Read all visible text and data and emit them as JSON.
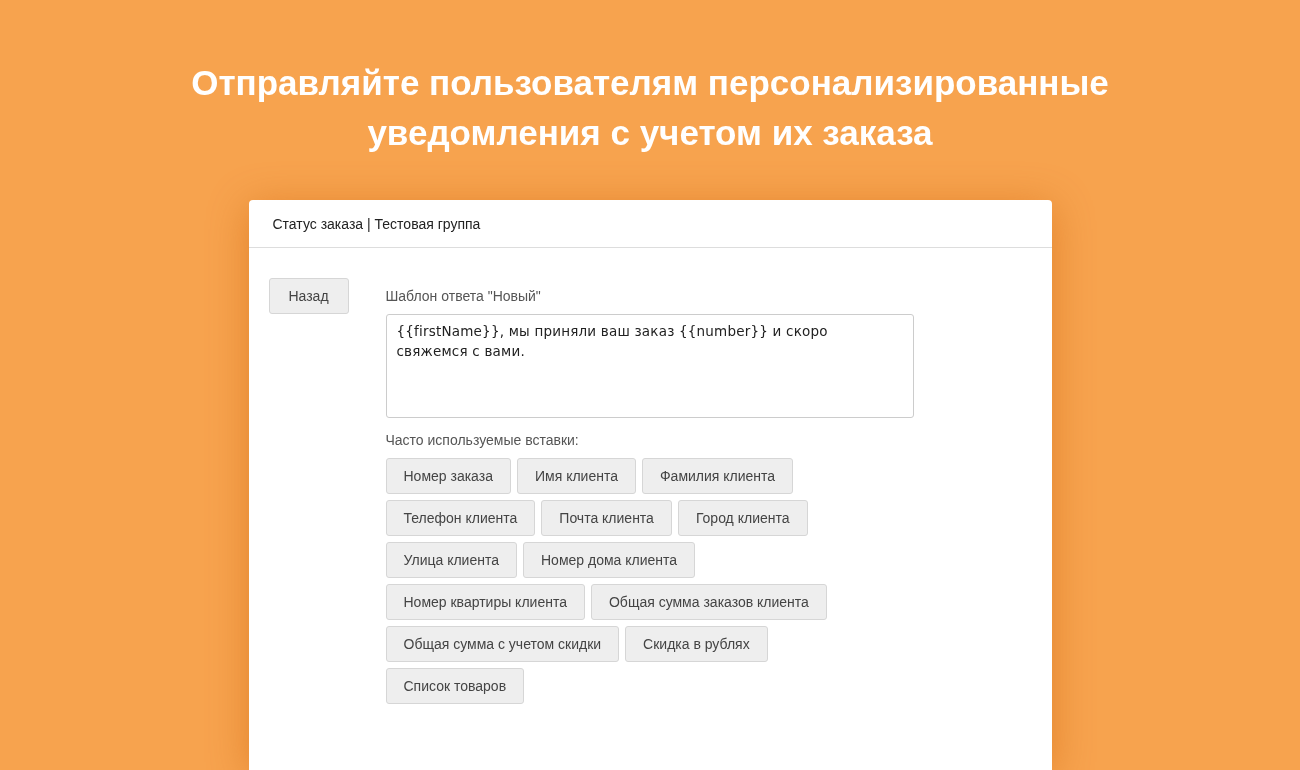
{
  "headline": "Отправляйте пользователям персонализированные уведомления с учетом их заказа",
  "card": {
    "title": "Статус заказа | Тестовая группа",
    "back_button": "Назад",
    "template_label": "Шаблон ответа \"Новый\"",
    "template_value": "{{firstName}}, мы приняли ваш заказ {{number}} и скоро свяжемся с вами.",
    "inserts_label": "Часто используемые вставки:",
    "inserts": [
      "Номер заказа",
      "Имя клиента",
      "Фамилия клиента",
      "Телефон клиента",
      "Почта клиента",
      "Город клиента",
      "Улица клиента",
      "Номер дома клиента",
      "Номер квартиры клиента",
      "Общая сумма заказов клиента",
      "Общая сумма с учетом скидки",
      "Скидка в рублях",
      "Список товаров"
    ]
  }
}
